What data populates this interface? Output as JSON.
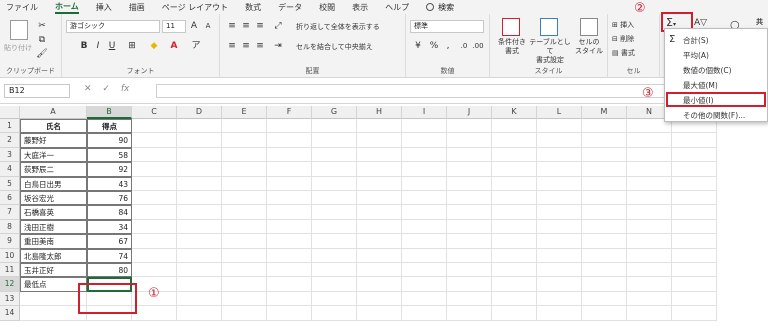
{
  "menu": {
    "tabs": [
      "ファイル",
      "ホーム",
      "挿入",
      "描画",
      "ページ レイアウト",
      "数式",
      "データ",
      "校閲",
      "表示",
      "ヘルプ"
    ],
    "active_tab": "ホーム",
    "search_label": "検索"
  },
  "ribbon": {
    "clipboard": {
      "label": "クリップボード",
      "paste": "貼り付け"
    },
    "font": {
      "label": "フォント",
      "family": "游ゴシック",
      "size": "11",
      "grow": "A^",
      "shrink": "A˅",
      "bold": "B",
      "italic": "I",
      "underline": "U"
    },
    "alignment": {
      "label": "配置",
      "wrap": "折り返して全体を表示する",
      "merge": "セルを結合して中央揃え"
    },
    "number": {
      "label": "数値",
      "format": "標準"
    },
    "styles": {
      "label": "スタイル",
      "conditional": "条件付き\n書式",
      "table": "テーブルとして\n書式設定",
      "cell_style": "セルの\nスタイル"
    },
    "cells": {
      "label": "セル",
      "insert": "挿入",
      "delete": "削除",
      "format": "書式"
    },
    "editing": {
      "sigma": "Σ",
      "share": "共"
    }
  },
  "formula_bar": {
    "name_box": "B12",
    "cancel": "✕",
    "enter": "✓",
    "fx": "fx",
    "value": ""
  },
  "sheet": {
    "columns": [
      "A",
      "B",
      "C",
      "D",
      "E",
      "F",
      "G",
      "H",
      "I",
      "J",
      "K",
      "L",
      "M",
      "N",
      "O"
    ],
    "rows": [
      "1",
      "2",
      "3",
      "4",
      "5",
      "6",
      "7",
      "8",
      "9",
      "10",
      "11",
      "12",
      "13",
      "14"
    ],
    "header_row": {
      "name": "氏名",
      "score": "得点"
    },
    "data": [
      {
        "name": "藤野好",
        "score": "90"
      },
      {
        "name": "大庭洋一",
        "score": "58"
      },
      {
        "name": "荻野辰二",
        "score": "92"
      },
      {
        "name": "白鳥日出男",
        "score": "43"
      },
      {
        "name": "坂谷宏光",
        "score": "76"
      },
      {
        "name": "石橋喜英",
        "score": "84"
      },
      {
        "name": "浅田正樹",
        "score": "34"
      },
      {
        "name": "重田美南",
        "score": "67"
      },
      {
        "name": "北島隆太郎",
        "score": "74"
      },
      {
        "name": "玉井正好",
        "score": "80"
      }
    ],
    "min_label": "最低点",
    "active_cell": "B12"
  },
  "autosum_menu": {
    "items": [
      "合計(S)",
      "平均(A)",
      "数値の個数(C)",
      "最大値(M)",
      "最小値(I)",
      "その他の関数(F)..."
    ],
    "highlighted": "最小値(I)"
  },
  "annotations": {
    "step1": "①",
    "step2": "②",
    "step3": "③"
  },
  "colors": {
    "excel_green": "#1e6b3a",
    "annotation_red": "#d0202e"
  }
}
